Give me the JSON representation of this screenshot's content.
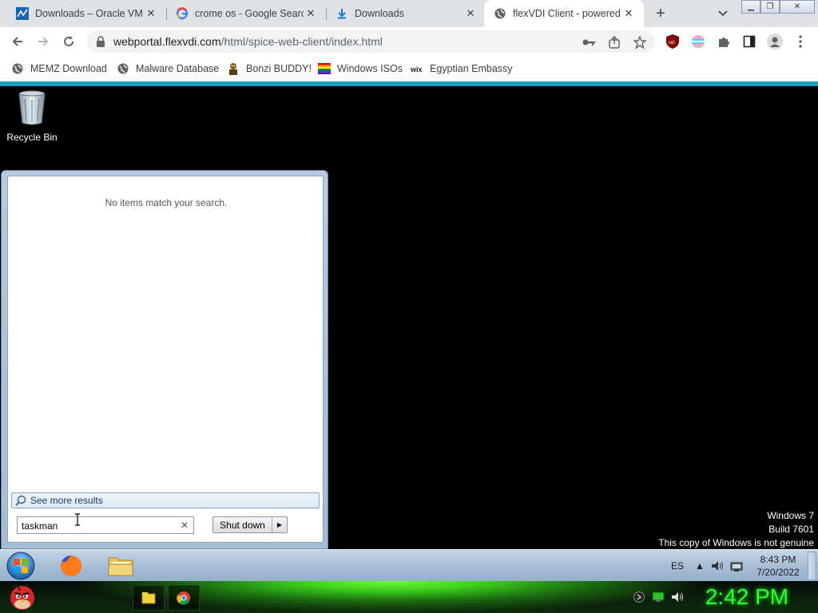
{
  "browser": {
    "tabs": [
      {
        "title": "Downloads – Oracle VM V",
        "icon": "oracle-vm-icon"
      },
      {
        "title": "crome os - Google Search",
        "icon": "google-icon"
      },
      {
        "title": "Downloads",
        "icon": "download-icon"
      },
      {
        "title": "flexVDI Client - powered",
        "icon": "globe-icon",
        "active": true
      }
    ],
    "url_host": "webportal.flexvdi.com",
    "url_path": "/html/spice-web-client/index.html",
    "bookmarks": [
      {
        "label": "MEMZ Download",
        "icon": "globe-icon"
      },
      {
        "label": "Malware Database",
        "icon": "globe-icon"
      },
      {
        "label": "Bonzi BUDDY!",
        "icon": "bonzi-icon"
      },
      {
        "label": "Windows ISOs",
        "icon": "rainbow-flag-icon"
      },
      {
        "label": "Egyptian Embassy",
        "icon": "wix-icon"
      }
    ],
    "accent": "#1ba1c0"
  },
  "remote": {
    "recycle_bin_label": "Recycle Bin",
    "start_menu": {
      "no_items_text": "No items match your search.",
      "see_more_label": "See more results",
      "search_value": "taskman",
      "shutdown_label": "Shut down"
    },
    "watermark": {
      "line1": "Windows 7",
      "line2": "Build 7601",
      "line3": "This copy of Windows is not genuine"
    },
    "taskbar": {
      "language": "ES",
      "time": "8:43 PM",
      "date": "7/20/2022"
    }
  },
  "host": {
    "clock": "2:42 PM",
    "clock_color": "#2bff3a"
  }
}
